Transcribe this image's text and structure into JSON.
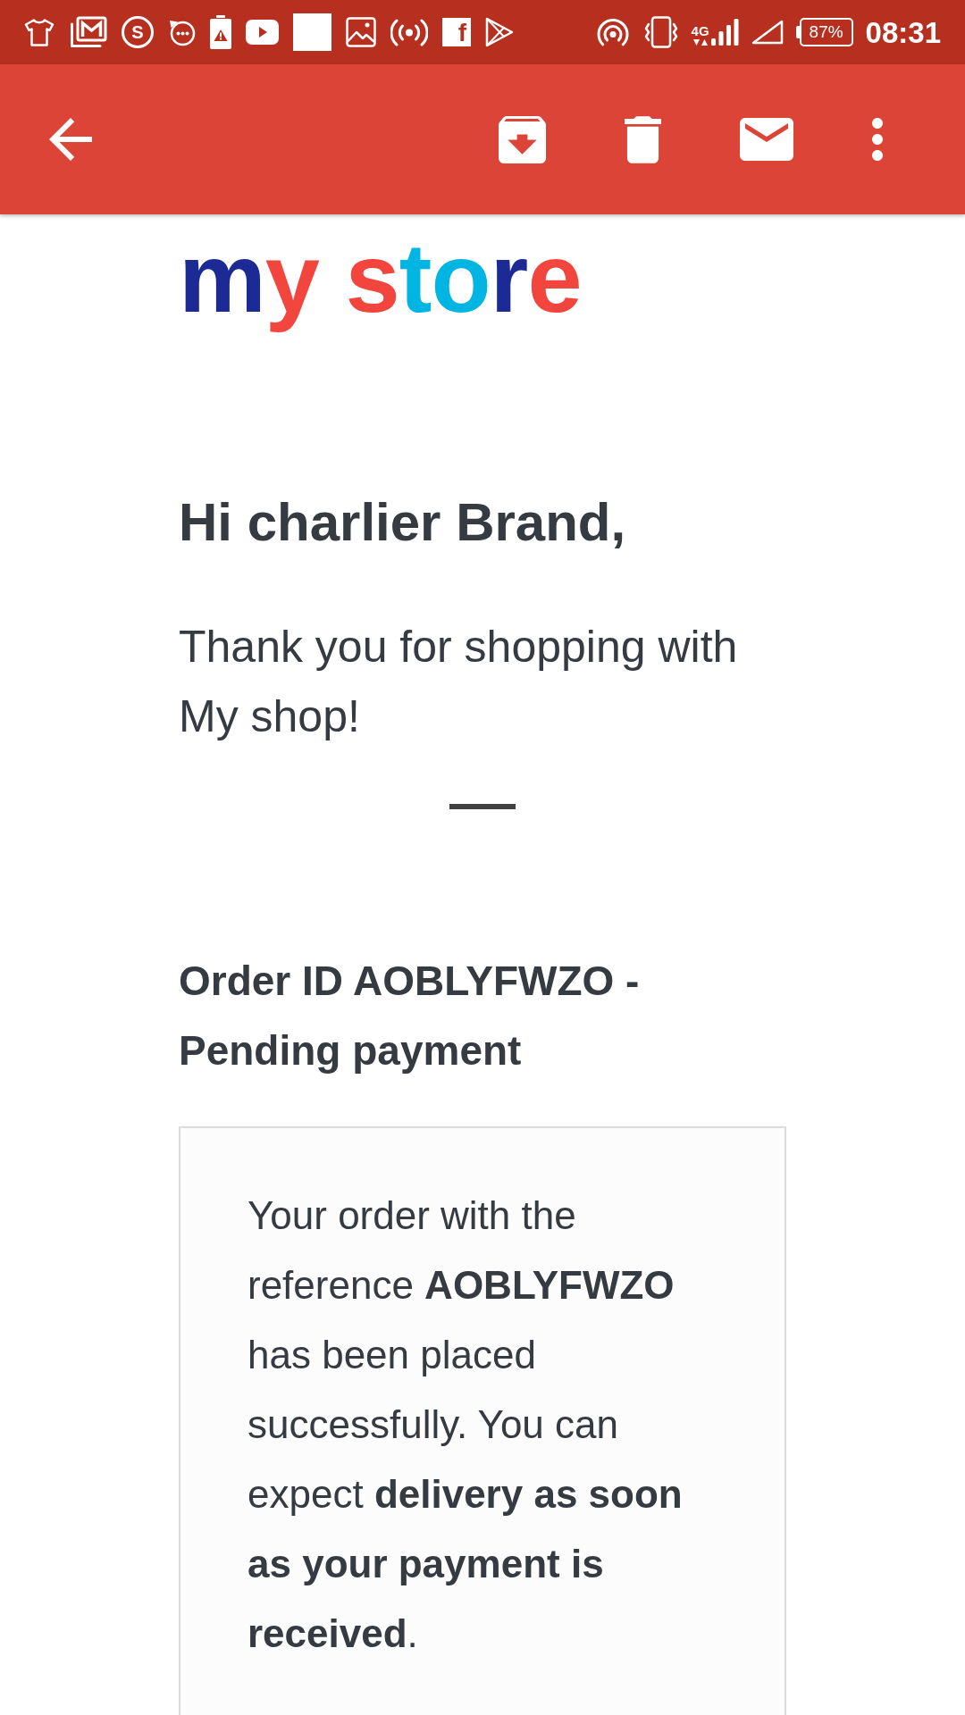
{
  "status_bar": {
    "circle_icon_letter": "S",
    "tile_icon_letter": "f",
    "network_type": "4G",
    "battery": "87%",
    "time": "08:31"
  },
  "email": {
    "logo": "my store",
    "greeting": "Hi charlier Brand,",
    "intro": "Thank you for shopping with My shop!",
    "order_heading": "Order ID AOBLYFWZO - Pending payment",
    "message": "Your order with the reference **AOBLYFWZO** has been placed successfully. You can expect **delivery as soon as your payment is received**."
  }
}
